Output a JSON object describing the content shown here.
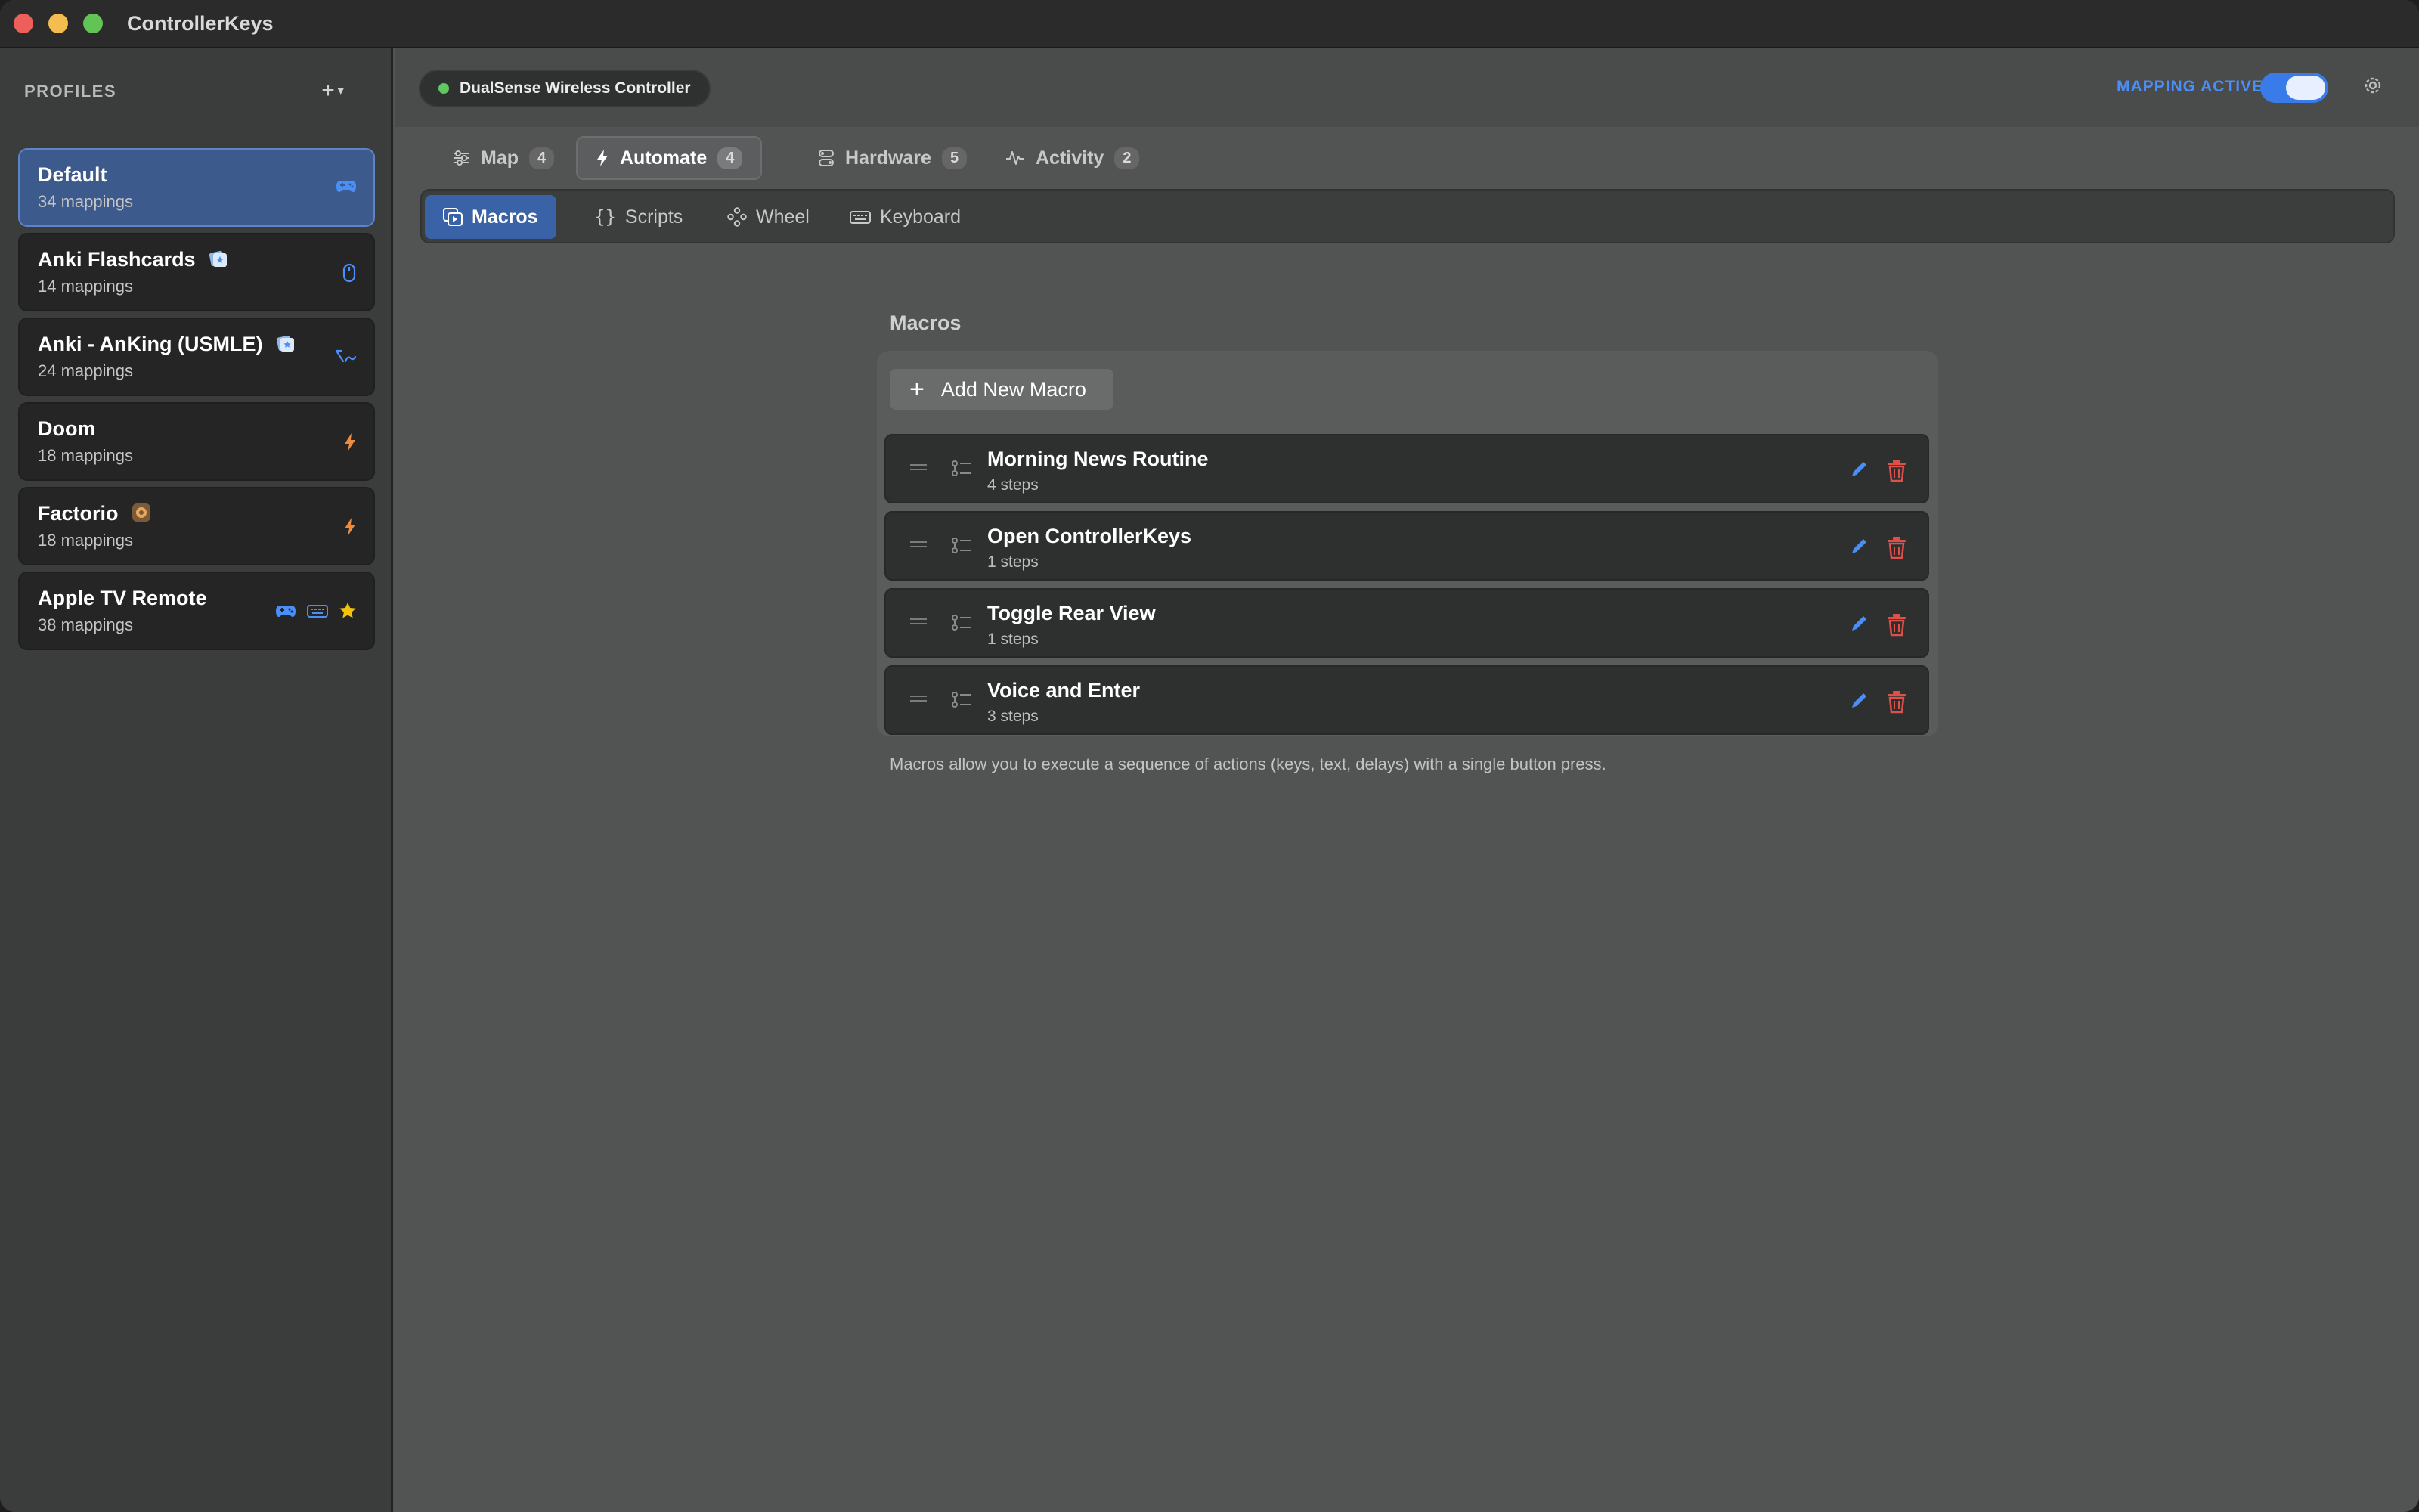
{
  "app": {
    "title": "ControllerKeys"
  },
  "sidebar": {
    "header": "PROFILES",
    "profiles": [
      {
        "name": "Default",
        "count": "34 mappings",
        "icons": [
          "gamepad-icon"
        ],
        "active": true
      },
      {
        "name": "Anki Flashcards",
        "count": "14 mappings",
        "icons": [
          "mouse-icon"
        ],
        "emoji": "anki-app-icon"
      },
      {
        "name": "Anki - AnKing (USMLE)",
        "count": "24 mappings",
        "icons": [
          "chords-icon"
        ],
        "emoji": "anki-app-icon"
      },
      {
        "name": "Doom",
        "count": "18 mappings",
        "icons": [
          "bolt-icon"
        ]
      },
      {
        "name": "Factorio",
        "count": "18 mappings",
        "icons": [
          "bolt-icon"
        ],
        "emoji": "factorio-app-icon"
      },
      {
        "name": "Apple TV Remote",
        "count": "38 mappings",
        "icons": [
          "gamepad-icon",
          "keyboard-icon",
          "star-icon"
        ]
      }
    ]
  },
  "header": {
    "device": "DualSense Wireless Controller",
    "mapping_label": "MAPPING ACTIVE",
    "mapping_active": true
  },
  "tabs": [
    {
      "label": "Map",
      "count": "4",
      "icon": "sliders-icon"
    },
    {
      "label": "Automate",
      "count": "4",
      "icon": "bolt-icon",
      "active": true
    },
    {
      "label": "Hardware",
      "count": "5",
      "icon": "hardware-icon"
    },
    {
      "label": "Activity",
      "count": "2",
      "icon": "activity-icon"
    }
  ],
  "subtabs": [
    {
      "label": "Macros",
      "icon": "macros-icon",
      "active": true
    },
    {
      "label": "Scripts",
      "icon": "braces-icon"
    },
    {
      "label": "Wheel",
      "icon": "wheel-icon"
    },
    {
      "label": "Keyboard",
      "icon": "keyboard-icon"
    }
  ],
  "content": {
    "title": "Macros",
    "add_label": "Add New Macro",
    "macros": [
      {
        "name": "Morning News Routine",
        "steps": "4 steps"
      },
      {
        "name": "Open ControllerKeys",
        "steps": "1 steps"
      },
      {
        "name": "Toggle Rear View",
        "steps": "1 steps"
      },
      {
        "name": "Voice and Enter",
        "steps": "3 steps"
      }
    ],
    "footnote": "Macros allow you to execute a sequence of actions (keys, text, delays) with a single button press."
  },
  "colors": {
    "accent": "#3a7bea",
    "active_profile": "#3c5a8c",
    "delete": "#e0504a",
    "bolt": "#f08a3c",
    "star": "#f4c20d"
  }
}
